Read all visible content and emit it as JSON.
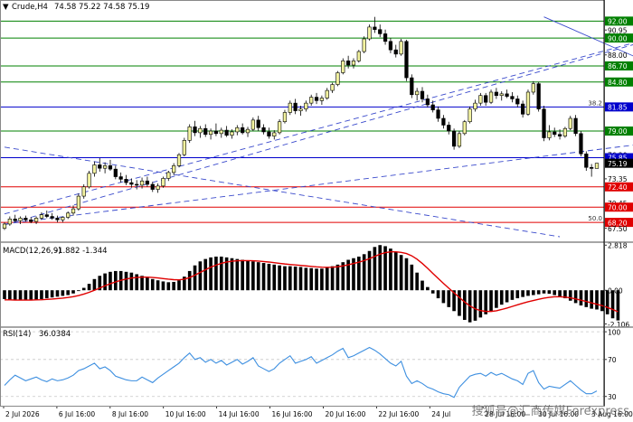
{
  "header": {
    "arrow": "▼",
    "symbol": "Crude,H4",
    "ohlc": "74.58 75.22 74.58 75.19"
  },
  "watermark": "搜狐号@汇商传媒Forexpress",
  "colors": {
    "bull": "#f2f2a0",
    "bear": "#000000",
    "green_line": "#008000",
    "red_line": "#e00000",
    "blue_line": "#0000cc",
    "trend_dash": "#3a4acc",
    "macd_signal": "#e00000",
    "rsi_line": "#3d8fe0",
    "grid": "#c8c8c8",
    "separator": "#888888"
  },
  "chart_data": [
    {
      "type": "candlestick",
      "panel": "price",
      "title": "Crude,H4",
      "ylim": [
        66.5,
        93.0
      ],
      "x_ticks": [
        "2 Jul 2026",
        "6 Jul 16:00",
        "8 Jul 16:00",
        "10 Jul 16:00",
        "14 Jul 16:00",
        "16 Jul 16:00",
        "20 Jul 16:00",
        "22 Jul 16:00",
        "24 Jul",
        "28 Jul 16:00",
        "30 Jul 16:00",
        "3 Aug 16:00"
      ],
      "y_ticks": [
        {
          "label": "92.00",
          "value": 92.0,
          "style": "green"
        },
        {
          "label": "90.95",
          "value": 90.95,
          "style": "plain"
        },
        {
          "label": "90.00",
          "value": 90.0,
          "style": "green"
        },
        {
          "label": "88.00",
          "value": 88.0,
          "style": "plain"
        },
        {
          "label": "86.70",
          "value": 86.7,
          "style": "green"
        },
        {
          "label": "84.80",
          "value": 84.8,
          "style": "green"
        },
        {
          "label": "81.85",
          "value": 81.85,
          "style": "blue"
        },
        {
          "label": "79.00",
          "value": 79.0,
          "style": "green"
        },
        {
          "label": "76.20",
          "value": 76.2,
          "style": "plain"
        },
        {
          "label": "75.85",
          "value": 75.85,
          "style": "blue"
        },
        {
          "label": "75.19",
          "value": 75.19,
          "style": "black"
        },
        {
          "label": "73.35",
          "value": 73.35,
          "style": "plain"
        },
        {
          "label": "72.40",
          "value": 72.4,
          "style": "red"
        },
        {
          "label": "70.45",
          "value": 70.45,
          "style": "plain"
        },
        {
          "label": "70.00",
          "value": 70.0,
          "style": "red"
        },
        {
          "label": "68.20",
          "value": 68.2,
          "style": "red"
        },
        {
          "label": "67.50",
          "value": 67.5,
          "style": "plain"
        }
      ],
      "levels": [
        {
          "value": 92.0,
          "color": "green"
        },
        {
          "value": 90.0,
          "color": "green"
        },
        {
          "value": 86.7,
          "color": "green"
        },
        {
          "value": 84.8,
          "color": "green"
        },
        {
          "value": 81.85,
          "color": "blue"
        },
        {
          "value": 79.0,
          "color": "green"
        },
        {
          "value": 75.85,
          "color": "blue"
        },
        {
          "value": 72.4,
          "color": "red"
        },
        {
          "value": 70.0,
          "color": "red"
        },
        {
          "value": 68.2,
          "color": "red"
        }
      ],
      "fib_labels": [
        {
          "label": "38.2",
          "value": 81.85
        },
        {
          "label": "50.0",
          "value": 68.2
        }
      ],
      "trendlines": [
        {
          "points": [
            [
              0,
              69.2
            ],
            [
              140,
              93.0
            ]
          ],
          "style": "dashed"
        },
        {
          "points": [
            [
              0,
              67.9
            ],
            [
              140,
              93.0
            ]
          ],
          "style": "dashed"
        },
        {
          "points": [
            [
              0,
              77.1
            ],
            [
              105,
              66.5
            ]
          ],
          "style": "dashed"
        },
        {
          "points": [
            [
              0,
              68.0
            ],
            [
              140,
              79.0
            ]
          ],
          "style": "dashed"
        },
        {
          "points": [
            [
              102,
              92.5
            ],
            [
              140,
              82.1
            ]
          ],
          "style": "solid"
        }
      ],
      "candles": [
        [
          67.5,
          68.2,
          67.3,
          68.0
        ],
        [
          68.0,
          68.9,
          67.8,
          68.6
        ],
        [
          68.6,
          69.1,
          68.2,
          68.4
        ],
        [
          68.4,
          68.9,
          68.0,
          68.7
        ],
        [
          68.7,
          69.0,
          68.3,
          68.5
        ],
        [
          68.5,
          68.8,
          68.1,
          68.3
        ],
        [
          68.3,
          68.9,
          68.0,
          68.7
        ],
        [
          68.7,
          69.4,
          68.5,
          69.1
        ],
        [
          69.1,
          69.6,
          68.7,
          68.9
        ],
        [
          68.9,
          69.3,
          68.5,
          68.7
        ],
        [
          68.7,
          69.0,
          68.2,
          68.5
        ],
        [
          68.5,
          68.9,
          68.2,
          68.8
        ],
        [
          68.8,
          69.5,
          68.6,
          69.3
        ],
        [
          69.3,
          70.2,
          69.0,
          69.8
        ],
        [
          69.8,
          71.6,
          69.6,
          71.3
        ],
        [
          71.3,
          72.7,
          71.0,
          72.4
        ],
        [
          72.4,
          74.3,
          72.2,
          74.0
        ],
        [
          74.0,
          75.4,
          73.6,
          75.0
        ],
        [
          75.0,
          75.8,
          74.2,
          74.6
        ],
        [
          74.6,
          75.3,
          74.0,
          74.9
        ],
        [
          74.9,
          75.6,
          74.3,
          74.5
        ],
        [
          74.5,
          74.9,
          73.3,
          73.6
        ],
        [
          73.6,
          74.1,
          72.9,
          73.3
        ],
        [
          73.3,
          73.8,
          72.6,
          72.9
        ],
        [
          72.9,
          73.4,
          72.3,
          72.7
        ],
        [
          72.7,
          73.2,
          72.1,
          72.6
        ],
        [
          72.6,
          73.5,
          72.2,
          73.1
        ],
        [
          73.1,
          73.6,
          72.4,
          72.7
        ],
        [
          72.7,
          73.0,
          71.8,
          72.1
        ],
        [
          72.1,
          72.8,
          71.7,
          72.5
        ],
        [
          72.5,
          73.6,
          72.3,
          73.4
        ],
        [
          73.4,
          74.3,
          73.1,
          74.1
        ],
        [
          74.1,
          75.2,
          73.8,
          74.9
        ],
        [
          74.9,
          76.4,
          74.7,
          76.2
        ],
        [
          76.2,
          78.2,
          76.0,
          77.9
        ],
        [
          77.9,
          79.8,
          77.6,
          79.5
        ],
        [
          79.5,
          80.2,
          78.4,
          78.8
        ],
        [
          78.8,
          79.6,
          78.2,
          79.3
        ],
        [
          79.3,
          79.8,
          78.3,
          78.6
        ],
        [
          78.6,
          79.3,
          78.0,
          79.0
        ],
        [
          79.0,
          79.9,
          78.4,
          78.7
        ],
        [
          78.7,
          79.4,
          78.2,
          79.1
        ],
        [
          79.1,
          79.6,
          78.3,
          78.5
        ],
        [
          78.5,
          79.2,
          78.1,
          78.9
        ],
        [
          78.9,
          79.7,
          78.5,
          79.4
        ],
        [
          79.4,
          79.9,
          78.6,
          78.8
        ],
        [
          78.8,
          79.5,
          78.3,
          79.2
        ],
        [
          79.2,
          80.6,
          79.0,
          80.3
        ],
        [
          80.3,
          80.8,
          79.0,
          79.4
        ],
        [
          79.4,
          79.8,
          78.6,
          78.9
        ],
        [
          78.9,
          79.4,
          78.1,
          78.4
        ],
        [
          78.4,
          79.1,
          78.0,
          78.8
        ],
        [
          78.8,
          80.4,
          78.6,
          80.1
        ],
        [
          80.1,
          81.5,
          79.9,
          81.2
        ],
        [
          81.2,
          82.6,
          80.9,
          82.3
        ],
        [
          82.3,
          82.8,
          81.0,
          81.4
        ],
        [
          81.4,
          82.0,
          80.8,
          81.6
        ],
        [
          81.6,
          82.6,
          81.3,
          82.3
        ],
        [
          82.3,
          83.3,
          82.0,
          83.0
        ],
        [
          83.0,
          83.5,
          82.2,
          82.6
        ],
        [
          82.6,
          83.2,
          82.1,
          82.9
        ],
        [
          82.9,
          84.1,
          82.7,
          83.8
        ],
        [
          83.8,
          84.7,
          83.5,
          84.5
        ],
        [
          84.5,
          86.1,
          84.3,
          85.9
        ],
        [
          85.9,
          87.6,
          85.7,
          87.3
        ],
        [
          87.3,
          87.9,
          86.4,
          86.8
        ],
        [
          86.8,
          87.6,
          86.4,
          87.3
        ],
        [
          87.3,
          88.6,
          87.1,
          88.4
        ],
        [
          88.4,
          90.2,
          88.2,
          89.9
        ],
        [
          89.9,
          91.6,
          89.7,
          91.3
        ],
        [
          91.3,
          92.5,
          90.6,
          91.0
        ],
        [
          91.0,
          91.6,
          90.1,
          90.5
        ],
        [
          90.5,
          91.0,
          89.2,
          89.6
        ],
        [
          89.6,
          90.0,
          88.2,
          88.6
        ],
        [
          88.6,
          89.2,
          87.7,
          88.1
        ],
        [
          88.1,
          89.9,
          87.9,
          89.6
        ],
        [
          89.6,
          89.8,
          84.9,
          85.3
        ],
        [
          85.3,
          85.7,
          82.9,
          83.3
        ],
        [
          83.3,
          84.1,
          82.6,
          83.7
        ],
        [
          83.7,
          84.2,
          82.4,
          82.8
        ],
        [
          82.8,
          83.3,
          81.8,
          82.1
        ],
        [
          82.1,
          82.6,
          81.2,
          81.5
        ],
        [
          81.5,
          81.9,
          80.1,
          80.5
        ],
        [
          80.5,
          80.9,
          79.3,
          79.7
        ],
        [
          79.7,
          80.1,
          78.6,
          79.0
        ],
        [
          79.0,
          79.3,
          76.8,
          77.2
        ],
        [
          77.2,
          79.0,
          77.0,
          78.7
        ],
        [
          78.7,
          80.3,
          78.5,
          80.1
        ],
        [
          80.1,
          81.9,
          79.9,
          81.6
        ],
        [
          81.6,
          82.7,
          81.3,
          82.3
        ],
        [
          82.3,
          83.5,
          82.0,
          83.2
        ],
        [
          83.2,
          83.5,
          82.0,
          82.4
        ],
        [
          82.4,
          83.9,
          82.2,
          83.6
        ],
        [
          83.6,
          84.1,
          82.8,
          83.2
        ],
        [
          83.2,
          83.7,
          82.6,
          83.4
        ],
        [
          83.4,
          83.9,
          82.9,
          83.1
        ],
        [
          83.1,
          83.6,
          82.4,
          82.8
        ],
        [
          82.8,
          83.2,
          81.8,
          82.2
        ],
        [
          82.2,
          82.6,
          80.6,
          81.0
        ],
        [
          81.0,
          83.9,
          80.8,
          83.6
        ],
        [
          83.6,
          84.9,
          83.3,
          84.6
        ],
        [
          84.6,
          84.8,
          81.3,
          81.6
        ],
        [
          81.6,
          82.0,
          77.8,
          78.2
        ],
        [
          78.2,
          79.7,
          77.9,
          78.9
        ],
        [
          78.9,
          79.4,
          78.3,
          78.6
        ],
        [
          78.6,
          79.2,
          78.0,
          78.4
        ],
        [
          78.4,
          79.5,
          78.2,
          79.3
        ],
        [
          79.3,
          80.8,
          79.1,
          80.5
        ],
        [
          80.5,
          80.9,
          78.4,
          78.7
        ],
        [
          78.7,
          79.0,
          76.0,
          76.3
        ],
        [
          76.3,
          76.6,
          74.3,
          74.7
        ],
        [
          74.7,
          75.1,
          73.6,
          74.58
        ],
        [
          74.58,
          75.22,
          74.58,
          75.19
        ]
      ]
    },
    {
      "type": "bar",
      "panel": "macd",
      "title": "MACD(12,26,9)",
      "values_label": "-1.882 -1.344",
      "ylim": [
        -2.3,
        3.0
      ],
      "y_ticks": [
        {
          "label": "2.818",
          "value": 2.818
        },
        {
          "label": "0.00",
          "value": 0.0
        },
        {
          "label": "-2.106",
          "value": -2.106
        }
      ],
      "histogram": [
        -0.55,
        -0.6,
        -0.62,
        -0.63,
        -0.62,
        -0.6,
        -0.58,
        -0.55,
        -0.5,
        -0.45,
        -0.4,
        -0.35,
        -0.3,
        -0.2,
        -0.05,
        0.15,
        0.4,
        0.7,
        0.9,
        1.05,
        1.15,
        1.2,
        1.2,
        1.15,
        1.1,
        1.0,
        0.9,
        0.8,
        0.7,
        0.62,
        0.55,
        0.5,
        0.52,
        0.62,
        0.85,
        1.2,
        1.55,
        1.8,
        1.95,
        2.05,
        2.1,
        2.1,
        2.05,
        2.0,
        1.95,
        1.9,
        1.85,
        1.8,
        1.75,
        1.7,
        1.65,
        1.6,
        1.55,
        1.5,
        1.5,
        1.48,
        1.45,
        1.4,
        1.38,
        1.35,
        1.35,
        1.4,
        1.5,
        1.6,
        1.75,
        1.9,
        2.0,
        2.1,
        2.25,
        2.45,
        2.7,
        2.818,
        2.75,
        2.6,
        2.4,
        2.2,
        2.0,
        1.6,
        1.1,
        0.6,
        0.2,
        -0.2,
        -0.5,
        -0.8,
        -1.05,
        -1.3,
        -1.6,
        -1.85,
        -2.0,
        -1.9,
        -1.7,
        -1.5,
        -1.3,
        -1.1,
        -0.9,
        -0.75,
        -0.6,
        -0.5,
        -0.42,
        -0.35,
        -0.3,
        -0.25,
        -0.2,
        -0.22,
        -0.3,
        -0.4,
        -0.5,
        -0.65,
        -0.8,
        -0.95,
        -1.05,
        -1.15,
        -1.2,
        -1.3,
        -1.5,
        -1.75,
        -1.882
      ],
      "signal": [
        -0.6,
        -0.6,
        -0.61,
        -0.61,
        -0.61,
        -0.61,
        -0.6,
        -0.59,
        -0.57,
        -0.55,
        -0.52,
        -0.49,
        -0.45,
        -0.4,
        -0.33,
        -0.24,
        -0.13,
        0.0,
        0.14,
        0.28,
        0.41,
        0.52,
        0.62,
        0.7,
        0.76,
        0.8,
        0.82,
        0.82,
        0.8,
        0.77,
        0.73,
        0.69,
        0.66,
        0.65,
        0.69,
        0.79,
        0.94,
        1.11,
        1.28,
        1.44,
        1.57,
        1.68,
        1.76,
        1.81,
        1.84,
        1.85,
        1.85,
        1.84,
        1.82,
        1.79,
        1.76,
        1.72,
        1.68,
        1.64,
        1.61,
        1.58,
        1.55,
        1.52,
        1.49,
        1.46,
        1.44,
        1.43,
        1.44,
        1.47,
        1.52,
        1.59,
        1.67,
        1.75,
        1.85,
        1.97,
        2.11,
        2.25,
        2.35,
        2.4,
        2.4,
        2.36,
        2.29,
        2.15,
        1.94,
        1.67,
        1.37,
        1.05,
        0.74,
        0.43,
        0.13,
        -0.16,
        -0.45,
        -0.73,
        -0.98,
        -1.16,
        -1.27,
        -1.32,
        -1.32,
        -1.28,
        -1.2,
        -1.11,
        -1.01,
        -0.91,
        -0.81,
        -0.72,
        -0.64,
        -0.56,
        -0.49,
        -0.44,
        -0.41,
        -0.41,
        -0.43,
        -0.47,
        -0.54,
        -0.62,
        -0.7,
        -0.79,
        -0.87,
        -0.96,
        -1.07,
        -1.2,
        -1.344
      ]
    },
    {
      "type": "line",
      "panel": "rsi",
      "title": "RSI(14)",
      "value_label": "36.0384",
      "ylim": [
        20,
        105
      ],
      "y_ticks": [
        {
          "label": "100",
          "value": 100
        },
        {
          "label": "70",
          "value": 70
        },
        {
          "label": "30",
          "value": 30
        }
      ],
      "values": [
        42,
        48,
        53,
        50,
        47,
        49,
        51,
        48,
        46,
        49,
        47,
        48,
        50,
        53,
        58,
        60,
        63,
        66,
        60,
        62,
        58,
        52,
        50,
        48,
        47,
        47,
        51,
        48,
        45,
        50,
        54,
        58,
        62,
        66,
        72,
        77,
        70,
        72,
        67,
        70,
        66,
        69,
        64,
        67,
        70,
        65,
        68,
        72,
        63,
        60,
        57,
        60,
        66,
        70,
        74,
        66,
        68,
        70,
        73,
        66,
        69,
        72,
        75,
        79,
        82,
        72,
        74,
        77,
        80,
        83,
        80,
        76,
        71,
        66,
        63,
        68,
        52,
        44,
        47,
        44,
        40,
        38,
        35,
        33,
        32,
        29,
        40,
        46,
        52,
        54,
        55,
        52,
        56,
        53,
        55,
        52,
        49,
        47,
        43,
        55,
        58,
        45,
        38,
        41,
        40,
        39,
        43,
        47,
        42,
        37,
        33,
        33,
        36.04
      ]
    }
  ]
}
